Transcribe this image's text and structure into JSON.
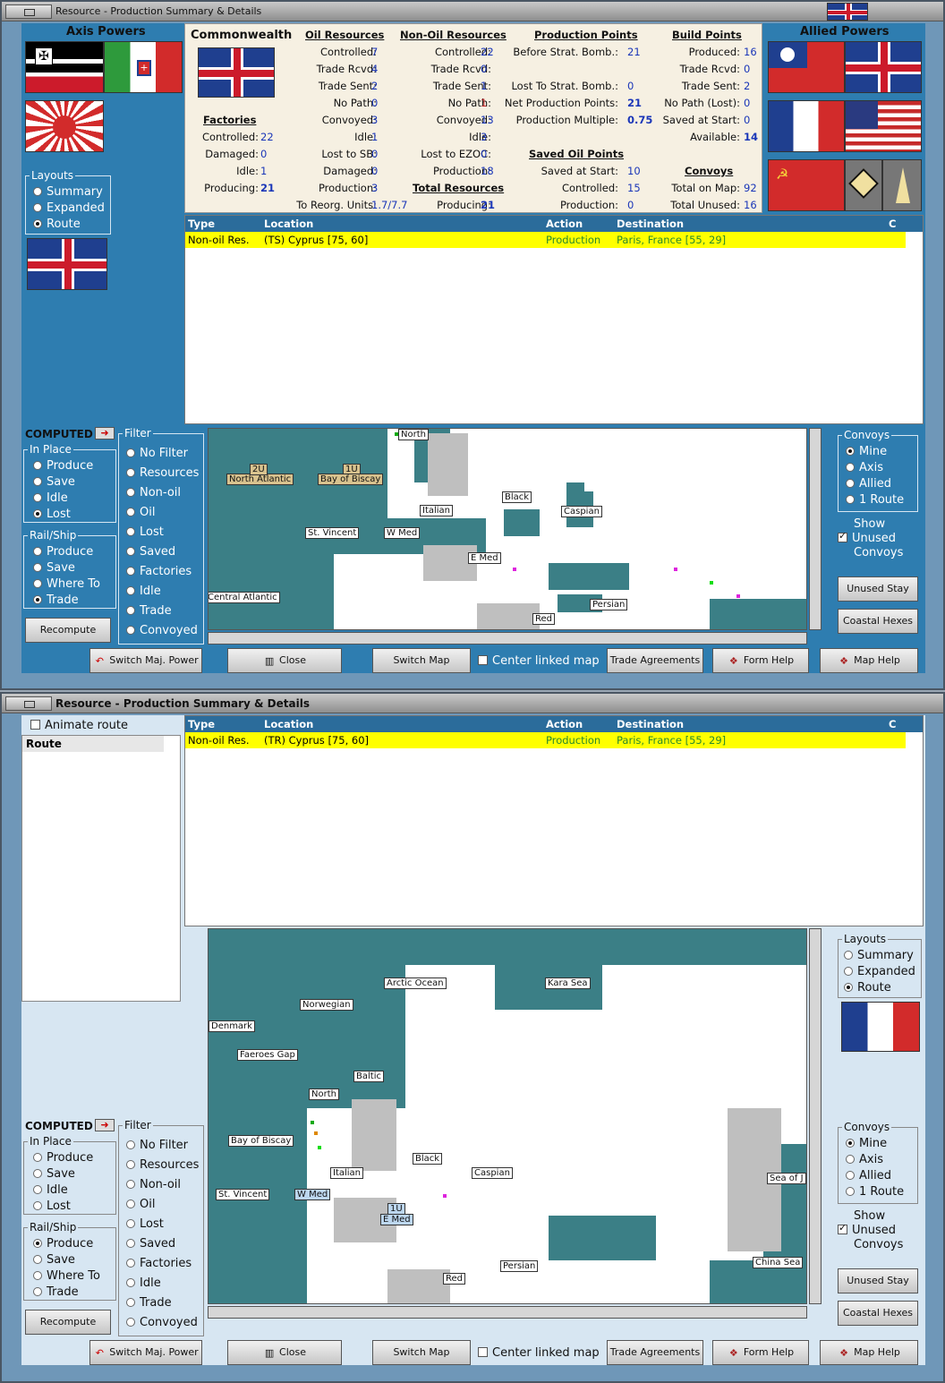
{
  "window1": {
    "title": "Resource - Production Summary & Details",
    "axis_header": "Axis Powers",
    "allied_header": "Allied Powers",
    "layouts": {
      "legend": "Layouts",
      "options": [
        "Summary",
        "Expanded",
        "Route"
      ],
      "selected": "Route"
    },
    "summary": {
      "power": "Commonwealth",
      "factories": {
        "title": "Factories",
        "rows": [
          [
            "Controlled:",
            "22"
          ],
          [
            "Damaged:",
            "0"
          ],
          [
            "Idle:",
            "1"
          ],
          [
            "Producing:",
            "21"
          ]
        ]
      },
      "oil": {
        "title": "Oil Resources",
        "rows": [
          [
            "Controlled:",
            "7"
          ],
          [
            "Trade Rcvd:",
            "4"
          ],
          [
            "Trade Sent:",
            "2"
          ],
          [
            "No Path:",
            "0"
          ],
          [
            "Convoyed:",
            "3"
          ],
          [
            "Idle:",
            "1"
          ],
          [
            "Lost to SB:",
            "0"
          ],
          [
            "Damaged:",
            "0"
          ],
          [
            "Production:",
            "3"
          ],
          [
            "To Reorg. Units:",
            "1.7/7.7"
          ]
        ]
      },
      "nonoil": {
        "title": "Non-Oil Resources",
        "rows": [
          [
            "Controlled:",
            "22"
          ],
          [
            "Trade Rcvd:",
            "0"
          ],
          [
            "Trade Sent:",
            "1"
          ],
          [
            "No Path:",
            "1"
          ],
          [
            "Convoyed:",
            "13"
          ],
          [
            "Idle:",
            "3"
          ],
          [
            "Lost to EZOC:",
            "0"
          ],
          [
            "Production:",
            "18"
          ]
        ]
      },
      "total": {
        "title": "Total Resources",
        "rows": [
          [
            "Producing:",
            "21"
          ]
        ]
      },
      "pp": {
        "title": "Production Points",
        "rows": [
          [
            "Before Strat. Bomb.:",
            "21"
          ],
          [
            "Lost To Strat. Bomb.:",
            "0"
          ],
          [
            "Net Production Points:",
            "21"
          ],
          [
            "Production Multiple:",
            "0.75"
          ]
        ]
      },
      "saved": {
        "title": "Saved Oil Points",
        "rows": [
          [
            "Saved at Start:",
            "10"
          ],
          [
            "Controlled:",
            "15"
          ],
          [
            "Production:",
            "0"
          ]
        ]
      },
      "bp": {
        "title": "Build Points",
        "rows": [
          [
            "Produced:",
            "16"
          ],
          [
            "Trade Rcvd:",
            "0"
          ],
          [
            "Trade Sent:",
            "2"
          ],
          [
            "No Path (Lost):",
            "0"
          ],
          [
            "Saved at Start:",
            "0"
          ],
          [
            "Available:",
            "14"
          ]
        ]
      },
      "convoys": {
        "title": "Convoys",
        "rows": [
          [
            "Total on Map:",
            "92"
          ],
          [
            "Total Unused:",
            "16"
          ]
        ]
      }
    },
    "grid": {
      "columns": [
        "Type",
        "Location",
        "Action",
        "Destination",
        "C"
      ],
      "row": [
        "Non-oil Res.",
        "(TS) Cyprus [75, 60]",
        "Production",
        "Paris, France [55, 29]",
        ""
      ]
    },
    "computed": "COMPUTED",
    "in_place": {
      "legend": "In Place",
      "options": [
        "Produce",
        "Save",
        "Idle",
        "Lost"
      ],
      "selected": "Lost"
    },
    "rail_ship": {
      "legend": "Rail/Ship",
      "options": [
        "Produce",
        "Save",
        "Where To",
        "Trade"
      ],
      "selected": "Trade"
    },
    "recompute": "Recompute",
    "filter": {
      "legend": "Filter",
      "options": [
        "No Filter",
        "Resources",
        "Non-oil",
        "Oil",
        "Lost",
        "Saved",
        "Factories",
        "Idle",
        "Trade",
        "Convoyed"
      ]
    },
    "convoys_box": {
      "legend": "Convoys",
      "options": [
        "Mine",
        "Axis",
        "Allied",
        "1 Route"
      ],
      "selected": "Mine"
    },
    "show_unused": [
      "Show",
      "Unused",
      "Convoys"
    ],
    "unused_stay": "Unused Stay",
    "coastal_hexes": "Coastal Hexes",
    "map_labels": [
      "North",
      "North Atlantic",
      "2U",
      "1U",
      "Bay of Biscay",
      "Italian",
      "Black",
      "Caspian",
      "St. Vincent",
      "W Med",
      "E Med",
      "Central Atlantic",
      "Persian",
      "Red"
    ],
    "buttons": [
      "Switch Maj. Power",
      "Close",
      "Switch Map",
      "Trade Agreements",
      "Form Help",
      "Map Help"
    ],
    "center_linked": "Center linked map"
  },
  "window2": {
    "title": "Resource - Production Summary & Details",
    "animate_route": "Animate route",
    "route_header": "Route",
    "grid": {
      "columns": [
        "Type",
        "Location",
        "Action",
        "Destination",
        "C"
      ],
      "row": [
        "Non-oil Res.",
        "(TR) Cyprus [75, 60]",
        "Production",
        "Paris, France [55, 29]",
        ""
      ]
    },
    "layouts": {
      "legend": "Layouts",
      "options": [
        "Summary",
        "Expanded",
        "Route"
      ],
      "selected": "Route"
    },
    "computed": "COMPUTED",
    "in_place": {
      "legend": "In Place",
      "options": [
        "Produce",
        "Save",
        "Idle",
        "Lost"
      ]
    },
    "rail_ship": {
      "legend": "Rail/Ship",
      "options": [
        "Produce",
        "Save",
        "Where To",
        "Trade"
      ],
      "selected": "Produce"
    },
    "recompute": "Recompute",
    "filter": {
      "legend": "Filter",
      "options": [
        "No Filter",
        "Resources",
        "Non-oil",
        "Oil",
        "Lost",
        "Saved",
        "Factories",
        "Idle",
        "Trade",
        "Convoyed"
      ]
    },
    "convoys_box": {
      "legend": "Convoys",
      "options": [
        "Mine",
        "Axis",
        "Allied",
        "1 Route"
      ],
      "selected": "Mine"
    },
    "show_unused": [
      "Show",
      "Unused",
      "Convoys"
    ],
    "unused_stay": "Unused Stay",
    "coastal_hexes": "Coastal Hexes",
    "map_labels": [
      "Arctic Ocean",
      "Kara Sea",
      "Norwegian",
      "Denmark",
      "Faeroes Gap",
      "Baltic",
      "North",
      "Bay of Biscay",
      "Black",
      "Italian",
      "Caspian",
      "St. Vincent",
      "W Med",
      "1U",
      "E Med",
      "Sea of J",
      "Persian",
      "China Sea",
      "Red"
    ],
    "buttons": [
      "Switch Maj. Power",
      "Close",
      "Switch Map",
      "Trade Agreements",
      "Form Help",
      "Map Help"
    ],
    "center_linked": "Center linked map"
  },
  "colors": {
    "window_blue": "#2e7db0",
    "sea": "#3b7f86",
    "highlight": "#ffff00",
    "header": "#2b6c9b"
  }
}
